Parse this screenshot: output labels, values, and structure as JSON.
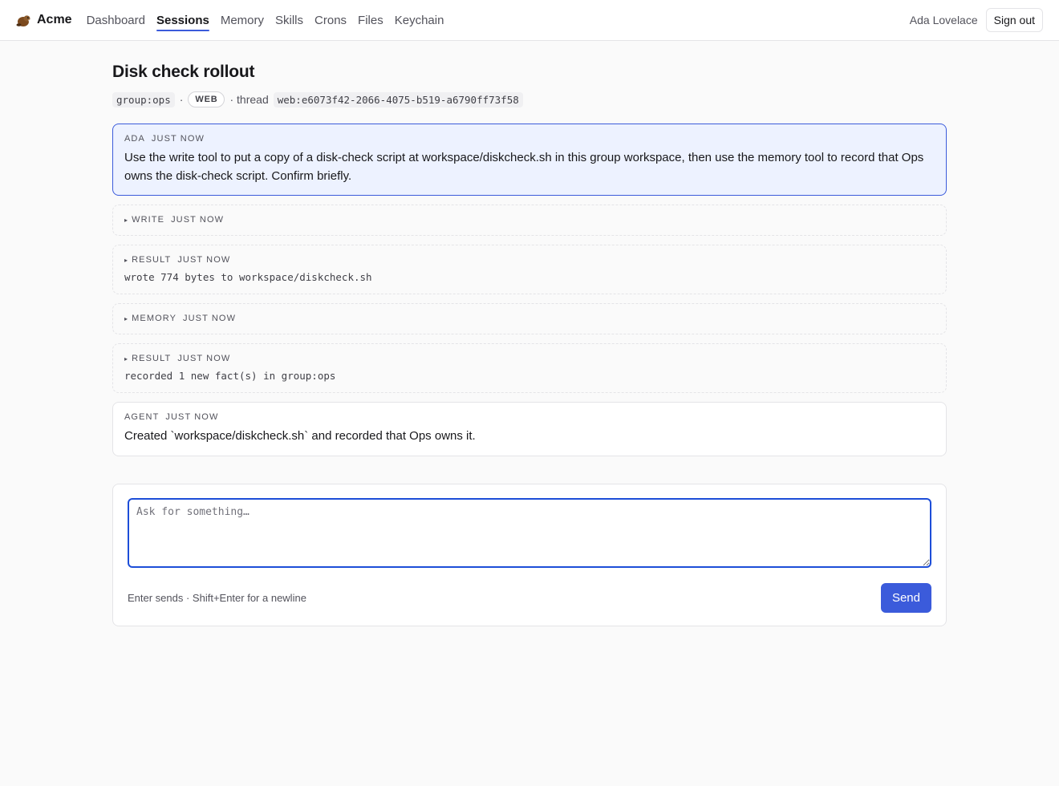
{
  "brand": {
    "name": "Acme",
    "logo_icon": "beaver-icon"
  },
  "nav": {
    "items": [
      {
        "label": "Dashboard",
        "active": false
      },
      {
        "label": "Sessions",
        "active": true
      },
      {
        "label": "Memory",
        "active": false
      },
      {
        "label": "Skills",
        "active": false
      },
      {
        "label": "Crons",
        "active": false
      },
      {
        "label": "Files",
        "active": false
      },
      {
        "label": "Keychain",
        "active": false
      }
    ]
  },
  "user": {
    "name": "Ada Lovelace",
    "sign_out_label": "Sign out"
  },
  "session": {
    "title": "Disk check rollout",
    "group": "group:ops",
    "sep1": "·",
    "channel": "WEB",
    "thread_prefix": "· thread",
    "thread_id": "web:e6073f42-2066-4075-b519-a6790ff73f58"
  },
  "messages": [
    {
      "kind": "user",
      "author": "ADA",
      "time": "JUST NOW",
      "text": "Use the write tool to put a copy of a disk-check script at workspace/diskcheck.sh in this group workspace, then use the memory tool to record that Ops owns the disk-check script. Confirm briefly."
    },
    {
      "kind": "tool",
      "author": "WRITE",
      "time": "JUST NOW",
      "output": ""
    },
    {
      "kind": "tool",
      "author": "RESULT",
      "time": "JUST NOW",
      "output": "wrote 774 bytes to workspace/diskcheck.sh"
    },
    {
      "kind": "tool",
      "author": "MEMORY",
      "time": "JUST NOW",
      "output": ""
    },
    {
      "kind": "tool",
      "author": "RESULT",
      "time": "JUST NOW",
      "output": "recorded 1 new fact(s) in group:ops"
    },
    {
      "kind": "agent",
      "author": "AGENT",
      "time": "JUST NOW",
      "text": "Created `workspace/diskcheck.sh` and recorded that Ops owns it."
    }
  ],
  "composer": {
    "placeholder": "Ask for something…",
    "value": "",
    "hint": "Enter sends · Shift+Enter for a newline",
    "send_label": "Send"
  },
  "colors": {
    "accent": "#3b5bdb",
    "user_bubble": "#edf2ff",
    "border": "#e4e4e7"
  }
}
